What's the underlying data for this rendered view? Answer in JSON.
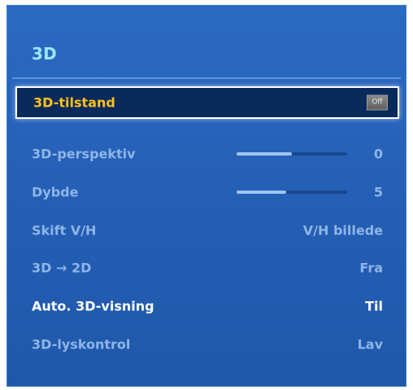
{
  "menu": {
    "title": "3D",
    "items": [
      {
        "label": "3D-tilstand",
        "value": "Off"
      },
      {
        "label": "3D-perspektiv",
        "value": "0",
        "level": 0.5
      },
      {
        "label": "Dybde",
        "value": "5",
        "level": 0.45
      },
      {
        "label": "Skift V/H",
        "value": "V/H billede"
      },
      {
        "label": "3D → 2D",
        "value": "Fra"
      },
      {
        "label": "Auto. 3D-visning",
        "value": "Til"
      },
      {
        "label": "3D-lyskontrol",
        "value": "Lav"
      }
    ]
  },
  "colors": {
    "panel": "#2560b6",
    "title": "#9be6ff",
    "selected_label": "#ffc21a",
    "dim_text": "#8fb5e8"
  }
}
